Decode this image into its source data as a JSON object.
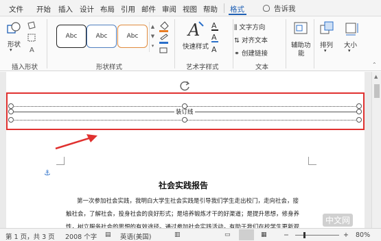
{
  "tabs": [
    "文件",
    "开始",
    "插入",
    "设计",
    "布局",
    "引用",
    "邮件",
    "审阅",
    "视图",
    "帮助",
    "格式"
  ],
  "active_tab": "格式",
  "tell_me": "告诉我",
  "ribbon": {
    "insert_shapes": {
      "shapes_label": "形状",
      "group_label": "插入形状"
    },
    "shape_styles": {
      "style_samples": [
        "Abc",
        "Abc",
        "Abc"
      ],
      "group_label": "形状样式"
    },
    "wordart": {
      "quick_styles_label": "快速样式",
      "group_label": "艺术字样式"
    },
    "text": {
      "direction": "文字方向",
      "align": "对齐文本",
      "link": "创建链接",
      "group_label": "文本"
    },
    "accessibility": {
      "label_line1": "辅助功",
      "label_line2": "能"
    },
    "arrange": {
      "label": "排列"
    },
    "size": {
      "label": "大小"
    }
  },
  "document": {
    "gutter_label": "装订线",
    "title": "社会实践报告",
    "paragraph_lines": [
      "第一次参加社会实践，我明白大学生社会实践是引导我们学生走出校门，走向社会，接",
      "触社会，了解社会，投身社会的良好形式；是培养锻炼才干的好渠道；是提升思想，修身养",
      "性，树立服务社会的思想的有效途径。通过参加社会实践活动，有助于我们在校学生更新观"
    ]
  },
  "status": {
    "page": "第 1 页，共 3 页",
    "words": "2008 个字",
    "language": "英语(美国)",
    "zoom": "80%"
  },
  "watermark": "中文网",
  "colors": {
    "accent": "#1e5fb4",
    "highlight": "#e0312f"
  }
}
